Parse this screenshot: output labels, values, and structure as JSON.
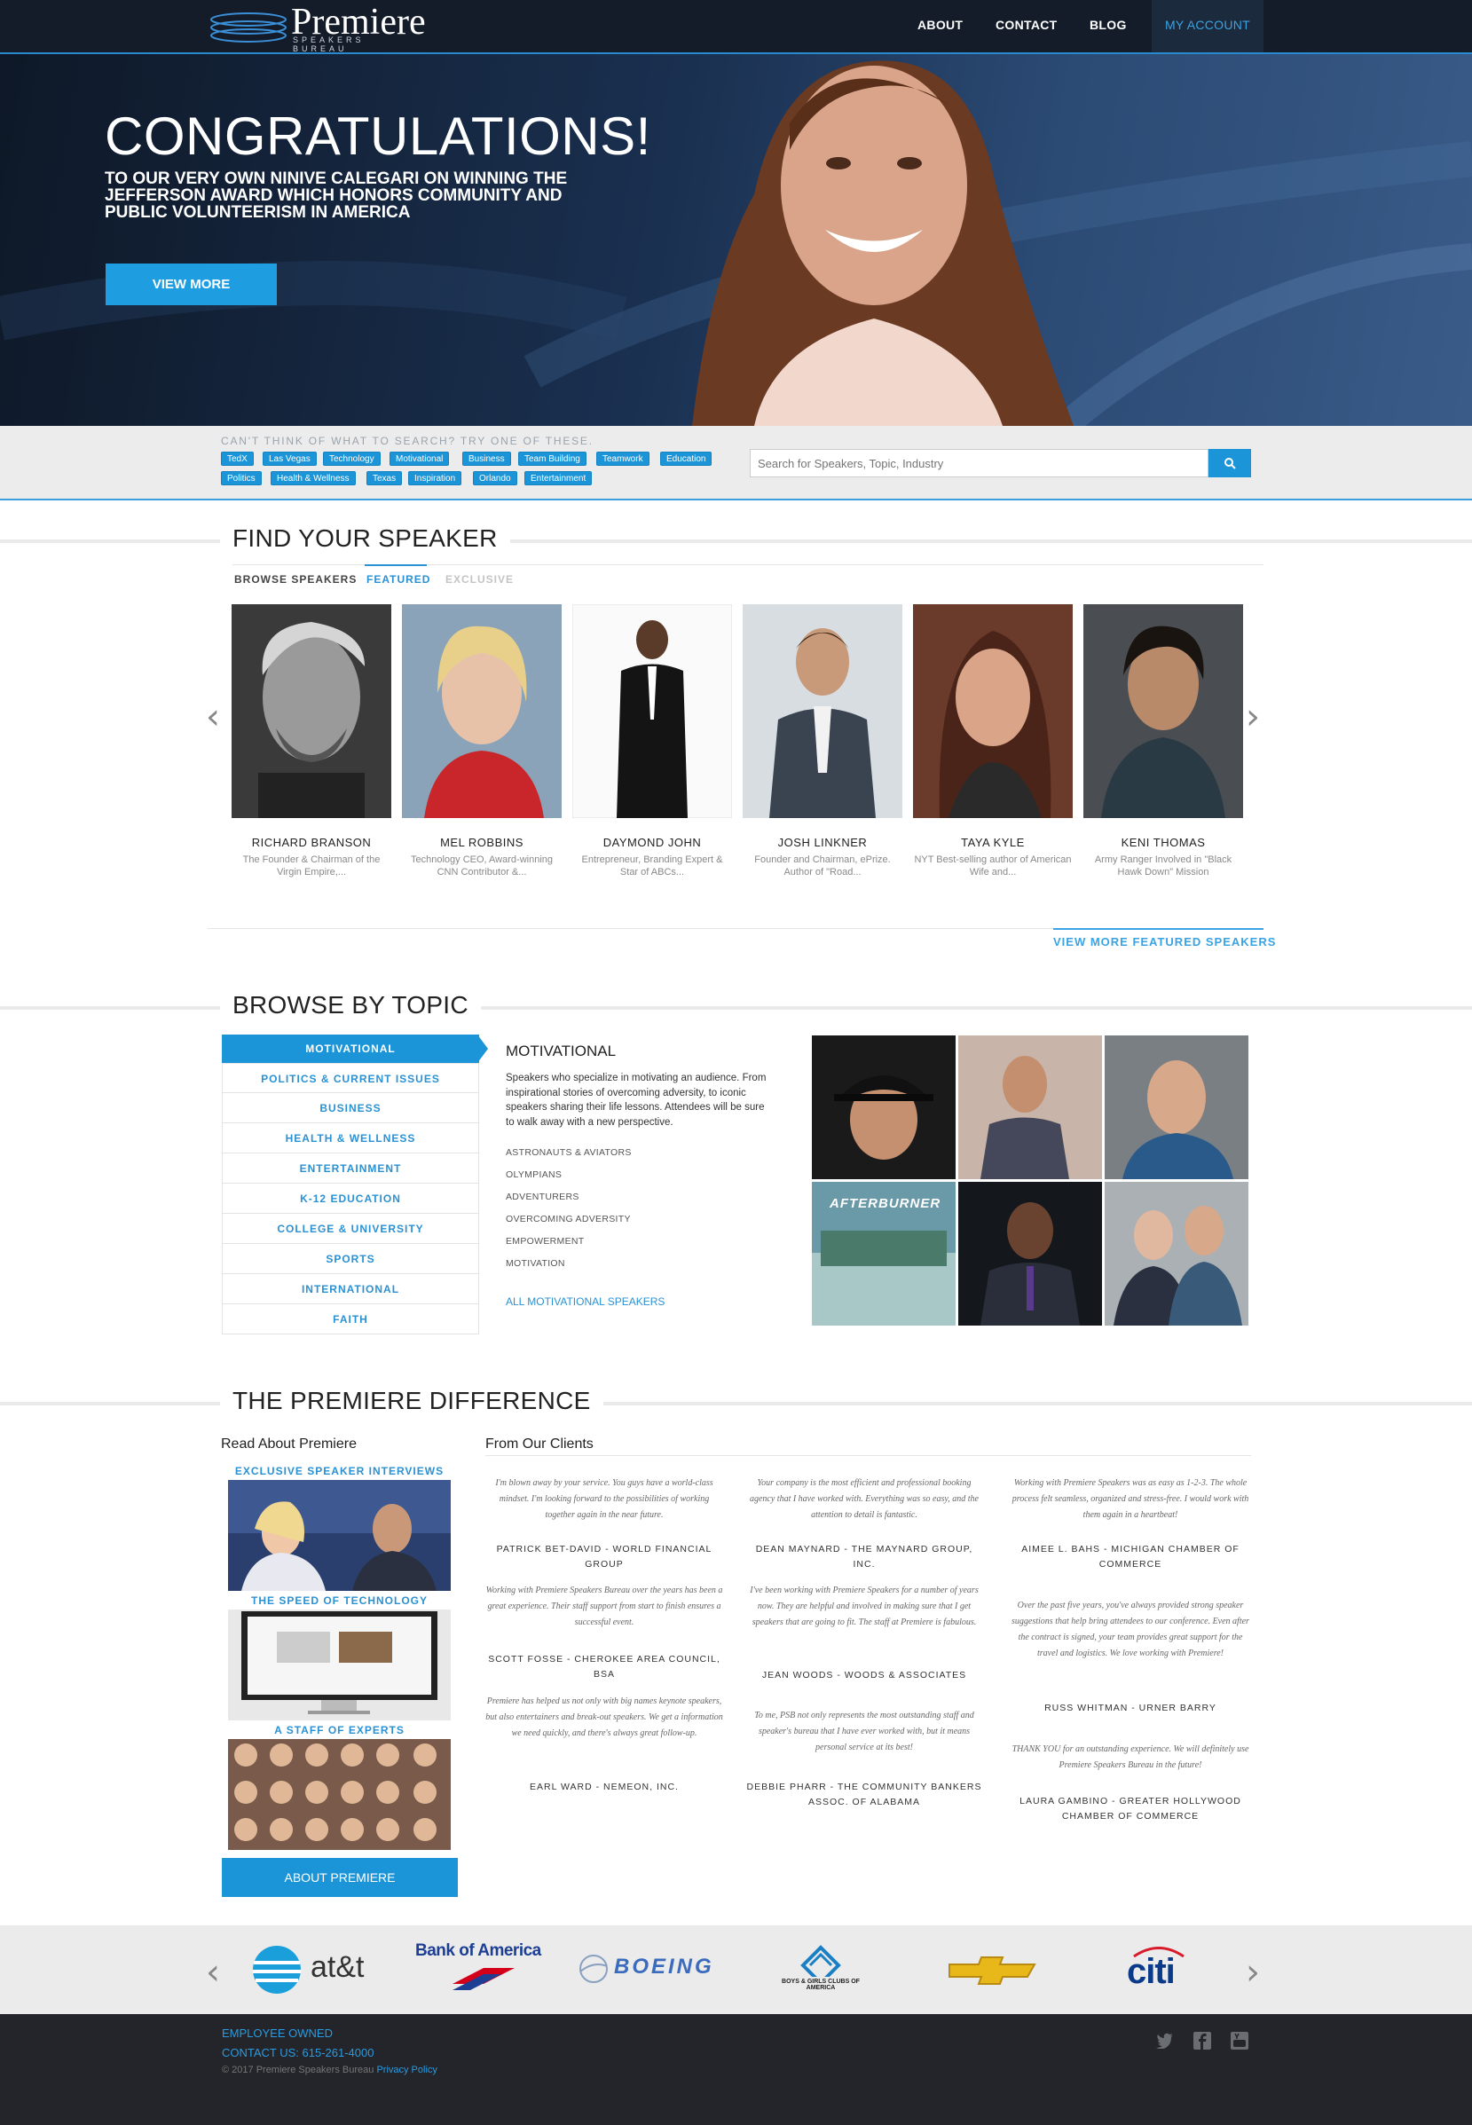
{
  "nav": {
    "logo_name": "Premiere",
    "logo_sub": "SPEAKERS BUREAU",
    "links": [
      "ABOUT",
      "CONTACT",
      "BLOG",
      "MY ACCOUNT"
    ]
  },
  "hero": {
    "title": "CONGRATULATIONS!",
    "subtitle": "TO OUR VERY OWN NINIVE CALEGARI ON WINNING THE JEFFERSON AWARD WHICH HONORS COMMUNITY AND PUBLIC VOLUNTEERISM IN AMERICA",
    "button": "VIEW MORE"
  },
  "search": {
    "hint": "CAN'T THINK OF WHAT TO SEARCH? TRY ONE OF THESE.",
    "tags": [
      "TedX",
      "Las Vegas",
      "Technology",
      "Motivational",
      "Business",
      "Team Building",
      "Teamwork",
      "Education",
      "Politics",
      "Health & Wellness",
      "Texas",
      "Inspiration",
      "Orlando",
      "Entertainment"
    ],
    "placeholder": "Search for Speakers, Topic, Industry",
    "button_icon": "search-icon"
  },
  "find": {
    "title": "FIND YOUR SPEAKER",
    "tabs": [
      "BROWSE SPEAKERS",
      "FEATURED",
      "EXCLUSIVE"
    ],
    "speakers": [
      {
        "name": "RICHARD BRANSON",
        "desc": "The Founder & Chairman of the Virgin Empire,..."
      },
      {
        "name": "MEL ROBBINS",
        "desc": "Technology CEO, Award-winning CNN Contributor &..."
      },
      {
        "name": "DAYMOND JOHN",
        "desc": "Entrepreneur, Branding Expert & Star of ABCs..."
      },
      {
        "name": "JOSH LINKNER",
        "desc": "Founder and Chairman, ePrize. Author of \"Road..."
      },
      {
        "name": "TAYA KYLE",
        "desc": "NYT Best-selling author of American Wife and..."
      },
      {
        "name": "KENI THOMAS",
        "desc": "Army Ranger Involved in \"Black Hawk Down\" Mission"
      }
    ],
    "view_more": "VIEW MORE FEATURED SPEAKERS"
  },
  "browse": {
    "title": "BROWSE BY TOPIC",
    "topics": [
      "MOTIVATIONAL",
      "POLITICS & CURRENT ISSUES",
      "BUSINESS",
      "HEALTH & WELLNESS",
      "ENTERTAINMENT",
      "K-12 EDUCATION",
      "COLLEGE & UNIVERSITY",
      "SPORTS",
      "INTERNATIONAL",
      "FAITH"
    ],
    "heading": "MOTIVATIONAL",
    "description": "Speakers who specialize in motivating an audience. From inspirational stories of overcoming adversity, to iconic speakers sharing their life lessons. Attendees will be sure to walk away with a new perspective.",
    "subtopics": [
      "ASTRONAUTS & AVIATORS",
      "OLYMPIANS",
      "ADVENTURERS",
      "OVERCOMING ADVERSITY",
      "EMPOWERMENT",
      "MOTIVATION"
    ],
    "all_link": "ALL MOTIVATIONAL SPEAKERS",
    "grid_banner": "AFTERBURNER"
  },
  "difference": {
    "title": "THE PREMIERE DIFFERENCE",
    "read_heading": "Read About Premiere",
    "read_items": [
      "EXCLUSIVE SPEAKER INTERVIEWS",
      "THE SPEED OF TECHNOLOGY",
      "A STAFF OF EXPERTS"
    ],
    "about_button": "ABOUT PREMIERE",
    "clients_heading": "From Our Clients",
    "testimonials": [
      {
        "quote": "I'm blown away by your service. You guys have a world-class mindset. I'm looking forward to the possibilities of working together again in the near future.",
        "author": "PATRICK BET-DAVID - WORLD FINANCIAL GROUP"
      },
      {
        "quote": "Working with Premiere Speakers Bureau over the years has been a great experience. Their staff support from start to finish ensures a successful event.",
        "author": "SCOTT FOSSE - CHEROKEE AREA COUNCIL, BSA"
      },
      {
        "quote": "Premiere has helped us not only with big names keynote speakers, but also entertainers and break-out speakers. We get a information we need quickly, and there's always great follow-up.",
        "author": "EARL WARD - NEMEON, INC."
      },
      {
        "quote": "Your company is the most efficient and professional booking agency that I have worked with. Everything was so easy, and the attention to detail is fantastic.",
        "author": "DEAN MAYNARD - THE MAYNARD GROUP, INC."
      },
      {
        "quote": "I've been working with Premiere Speakers for a number of years now. They are helpful and involved in making sure that I get speakers that are going to fit. The staff at Premiere is fabulous.",
        "author": "JEAN WOODS - WOODS & ASSOCIATES"
      },
      {
        "quote": "To me, PSB not only represents the most outstanding staff and speaker's bureau that I have ever worked with, but it means personal service at its best!",
        "author": "DEBBIE PHARR - THE COMMUNITY BANKERS ASSOC. OF ALABAMA"
      },
      {
        "quote": "Working with Premiere Speakers was as easy as 1-2-3. The whole process felt seamless, organized and stress-free. I would work with them again in a heartbeat!",
        "author": "AIMEE L. BAHS - MICHIGAN CHAMBER OF COMMERCE"
      },
      {
        "quote": "Over the past five years, you've always provided strong speaker suggestions that help bring attendees to our conference. Even after the contract is signed, your team provides great support for the travel and logistics. We love working with Premiere!",
        "author": "RUSS WHITMAN - URNER BARRY"
      },
      {
        "quote": "THANK YOU for an outstanding experience. We will definitely use Premiere Speakers Bureau in the future!",
        "author": "LAURA GAMBINO - GREATER HOLLYWOOD CHAMBER OF COMMERCE"
      }
    ]
  },
  "clients_logos": {
    "att": "at&t",
    "bofa": "Bank of America",
    "boeing": "BOEING",
    "bgc": "BOYS & GIRLS CLUBS OF AMERICA",
    "citi": "citi"
  },
  "footer": {
    "employee": "EMPLOYEE OWNED",
    "contact": "CONTACT US: 615-261-4000",
    "copyright": "© 2017 Premiere Speakers Bureau",
    "privacy": "Privacy Policy"
  },
  "colors": {
    "accent": "#1c95d8",
    "nav_bg": "#141c2a",
    "footer_bg": "#23252a"
  }
}
